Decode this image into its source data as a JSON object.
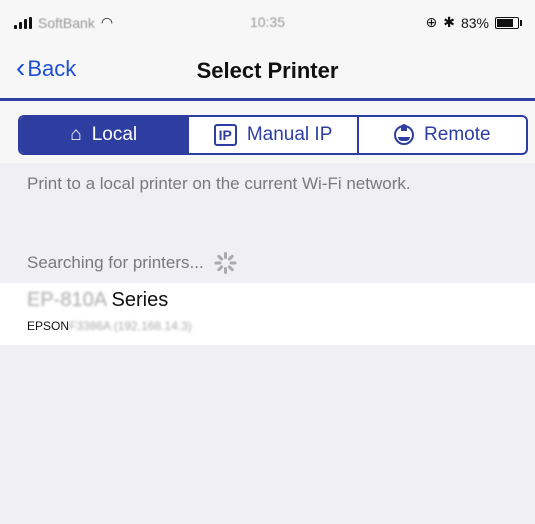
{
  "status": {
    "carrier": "SoftBank",
    "time": "10:35",
    "battery": "83%"
  },
  "nav": {
    "back_label": "Back",
    "title": "Select Printer"
  },
  "tabs": [
    {
      "label": "Local",
      "active": true
    },
    {
      "label": "Manual IP",
      "active": false
    },
    {
      "label": "Remote",
      "active": false
    }
  ],
  "description": "Print to a local printer on the current Wi-Fi network.",
  "searching_label": "Searching for printers...",
  "printer": {
    "model_prefix": "EP-810A",
    "series_label": "Series",
    "vendor": "EPSON",
    "identifier": "F3386A (192.168.14.3)"
  },
  "colors": {
    "accent": "#2e3ea0",
    "link": "#1b4fd6"
  }
}
